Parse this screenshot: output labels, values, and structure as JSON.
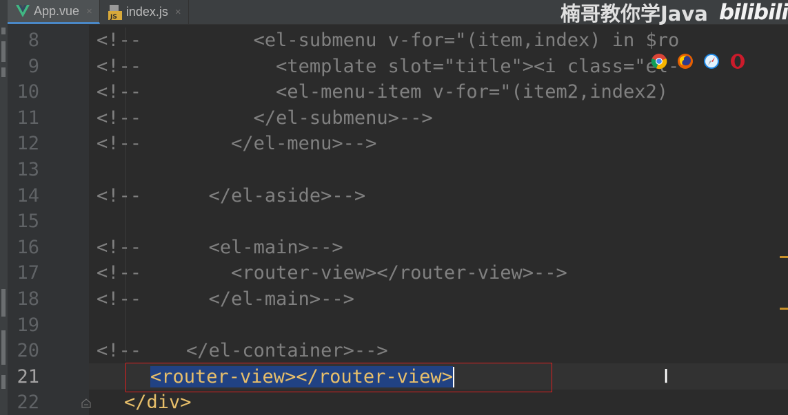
{
  "tabs": [
    {
      "label": "App.vue",
      "icon": "vue-icon",
      "active": true
    },
    {
      "label": "index.js",
      "icon": "js-file-icon",
      "active": false
    }
  ],
  "tab_close_glyph": "×",
  "watermark": {
    "text": "楠哥教你学Java",
    "logo_text": "bilibili"
  },
  "browser_icons": [
    "chrome-icon",
    "firefox-icon",
    "safari-icon",
    "opera-icon"
  ],
  "editor": {
    "current_line": 21,
    "lines": [
      {
        "num": "8",
        "comment": "<!--",
        "code": "          <el-submenu v-for=\"(item,index) in $ro"
      },
      {
        "num": "9",
        "comment": "<!--",
        "code": "            <template slot=\"title\"><i class=\"el-"
      },
      {
        "num": "10",
        "comment": "<!--",
        "code": "            <el-menu-item v-for=\"(item2,index2)"
      },
      {
        "num": "11",
        "comment": "<!--",
        "code": "          </el-submenu>-->"
      },
      {
        "num": "12",
        "comment": "<!--",
        "code": "        </el-menu>-->"
      },
      {
        "num": "13",
        "comment": "",
        "code": ""
      },
      {
        "num": "14",
        "comment": "<!--",
        "code": "      </el-aside>-->"
      },
      {
        "num": "15",
        "comment": "",
        "code": ""
      },
      {
        "num": "16",
        "comment": "<!--",
        "code": "      <el-main>-->"
      },
      {
        "num": "17",
        "comment": "<!--",
        "code": "        <router-view></router-view>-->"
      },
      {
        "num": "18",
        "comment": "<!--",
        "code": "      </el-main>-->"
      },
      {
        "num": "19",
        "comment": "",
        "code": ""
      },
      {
        "num": "20",
        "comment": "<!--",
        "code": "    </el-container>-->"
      },
      {
        "num": "21",
        "comment": "",
        "code": "<router-view></router-view>"
      },
      {
        "num": "22",
        "comment": "",
        "code": "</div>"
      }
    ]
  },
  "colors": {
    "background": "#2b2b2b",
    "comment": "#808080",
    "tag": "#e8bf6a",
    "selection": "#214283",
    "highlight_box": "#e02020"
  }
}
